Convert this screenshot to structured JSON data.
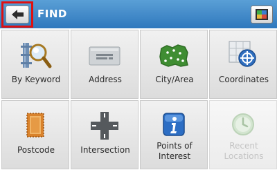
{
  "header": {
    "title": "FIND"
  },
  "icons": {
    "back": "back-arrow-icon",
    "map": "map-view-icon"
  },
  "colors": {
    "header_blue": "#3a86c8",
    "highlight_outline": "#e01010"
  },
  "tiles": [
    {
      "label": "By Keyword",
      "icon": "keyword-search-icon",
      "enabled": true
    },
    {
      "label": "Address",
      "icon": "address-card-icon",
      "enabled": true
    },
    {
      "label": "City/Area",
      "icon": "city-area-map-icon",
      "enabled": true
    },
    {
      "label": "Coordinates",
      "icon": "coordinates-crosshair-icon",
      "enabled": true
    },
    {
      "label": "Postcode",
      "icon": "postage-stamp-icon",
      "enabled": true
    },
    {
      "label": "Intersection",
      "icon": "road-intersection-icon",
      "enabled": true
    },
    {
      "label": "Points of Interest",
      "icon": "info-poi-icon",
      "enabled": true
    },
    {
      "label": "Recent Locations",
      "icon": "recent-clock-icon",
      "enabled": false
    }
  ]
}
